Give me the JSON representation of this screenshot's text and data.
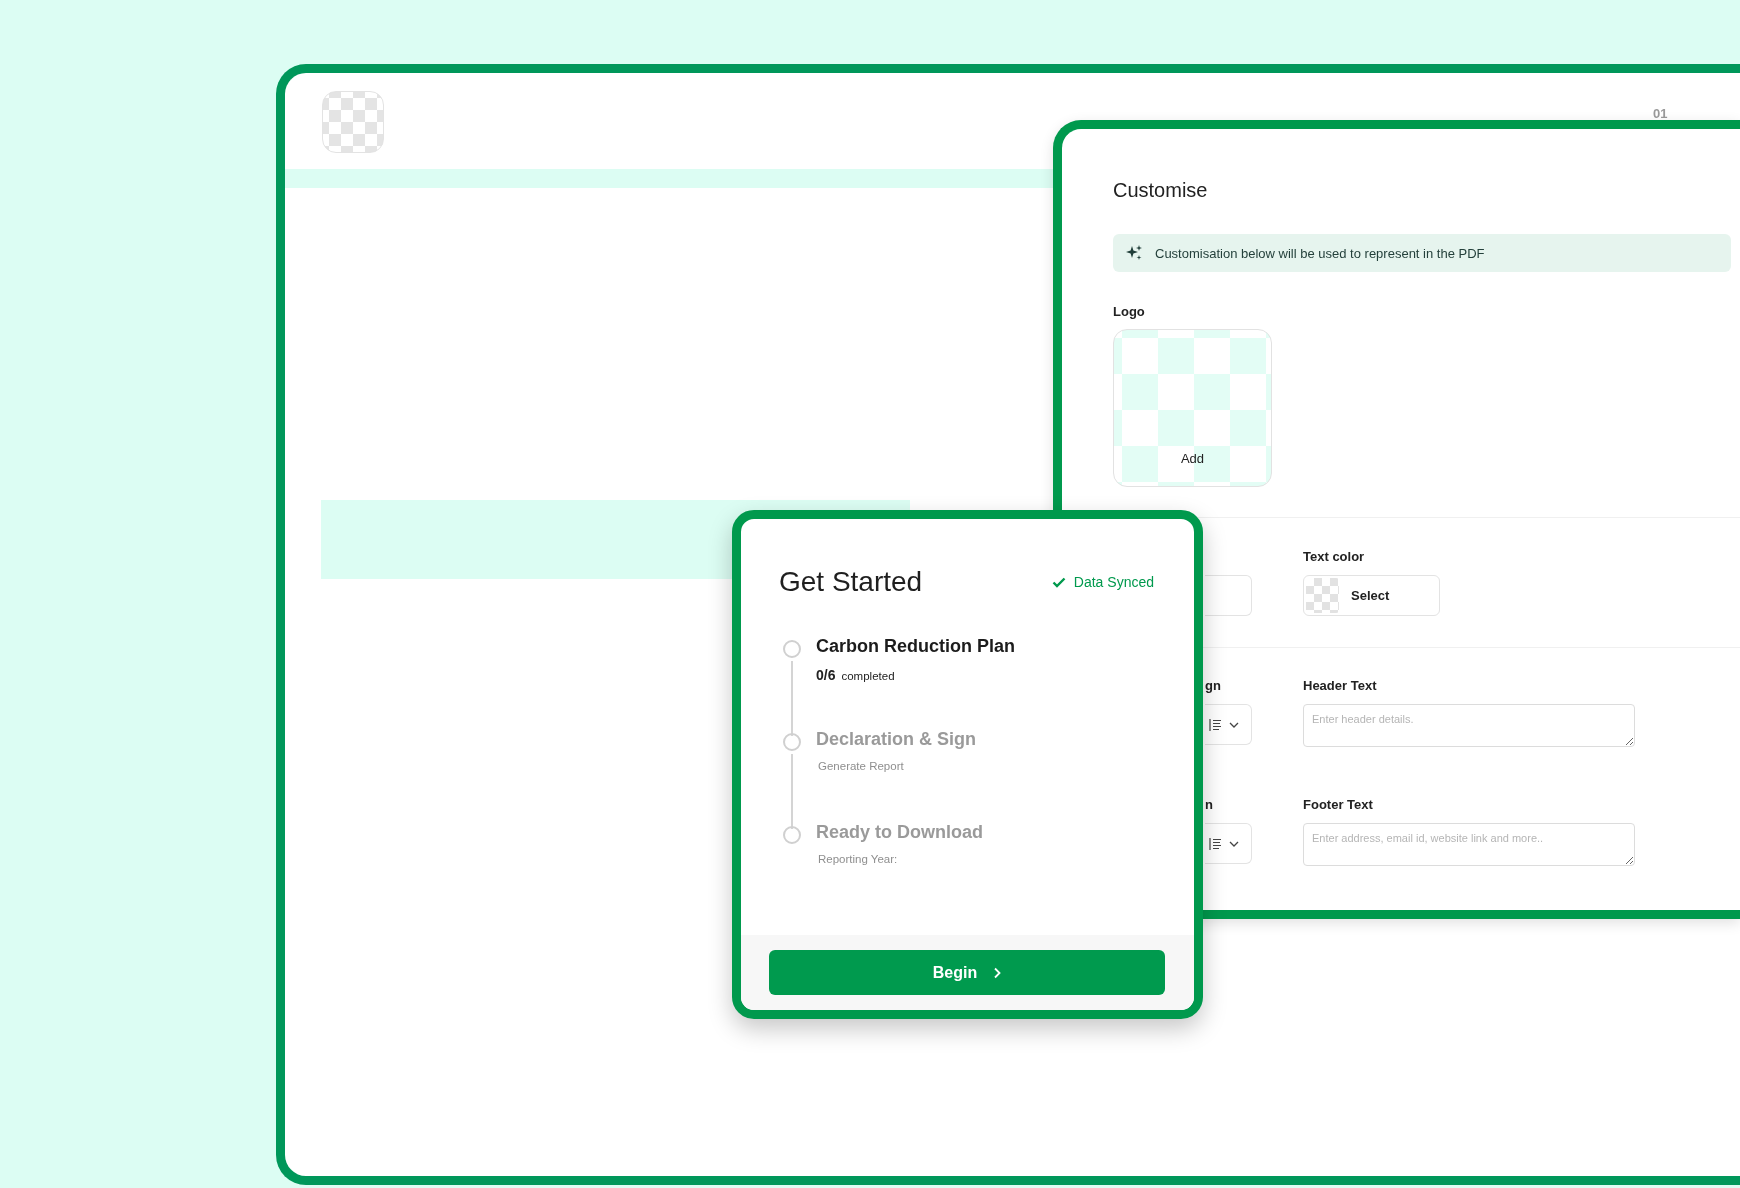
{
  "app": {
    "page_number": "01"
  },
  "customise": {
    "title": "Customise",
    "notice": "Customisation below will be used to represent in the PDF",
    "logo": {
      "label": "Logo",
      "action": "Add"
    },
    "text_color": {
      "label": "Text color",
      "button": "Select"
    },
    "rows": [
      {
        "partial_label": "gn",
        "label": "Header Text",
        "placeholder": "Enter header details."
      },
      {
        "partial_label": "n",
        "label": "Footer Text",
        "placeholder": "Enter address, email id, website link and more.."
      }
    ]
  },
  "get_started": {
    "title": "Get Started",
    "sync_status": "Data Synced",
    "steps": [
      {
        "title": "Carbon Reduction Plan",
        "count": "0/6",
        "detail": "completed",
        "active": true
      },
      {
        "title": "Declaration & Sign",
        "detail": "Generate Report",
        "active": false
      },
      {
        "title": "Ready to Download",
        "detail": "Reporting Year:",
        "active": false
      }
    ],
    "button": "Begin"
  }
}
